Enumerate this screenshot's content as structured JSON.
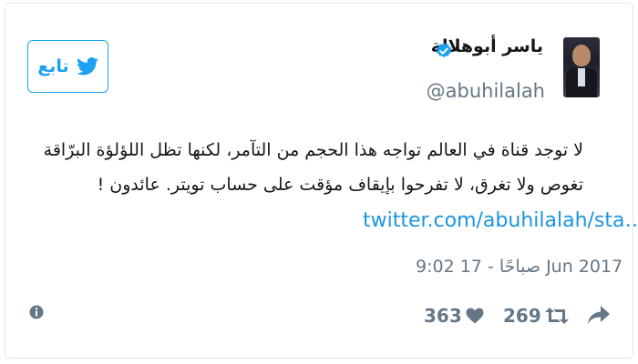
{
  "author": {
    "display_name": "ياسر أبوهلالة",
    "handle": "@abuhilalah",
    "verified": true
  },
  "follow_button": {
    "label": "تابع",
    "icon": "twitter-bird-icon"
  },
  "tweet": {
    "text": "لا توجد قناة في العالم تواجه هذا الحجم من التآمر، لكنها تظل اللؤلؤة البرّاقة تغوص ولا تغرق، لا تفرحوا بإيقاف مؤقت على حساب تويتر. عائدون !",
    "link": "twitter.com/abuhilalah/sta…",
    "timestamp": "9:02 صباحًا - 17 Jun 2017"
  },
  "actions": {
    "info_icon": "info-icon",
    "likes_count": "363",
    "likes_icon": "heart-icon",
    "retweets_count": "269",
    "retweets_icon": "retweet-icon",
    "share_icon": "share-icon"
  },
  "colors": {
    "accent": "#1da1f2",
    "link": "#1b95e0",
    "muted": "#657786",
    "text": "#14171a",
    "border": "#e1e8ed"
  }
}
